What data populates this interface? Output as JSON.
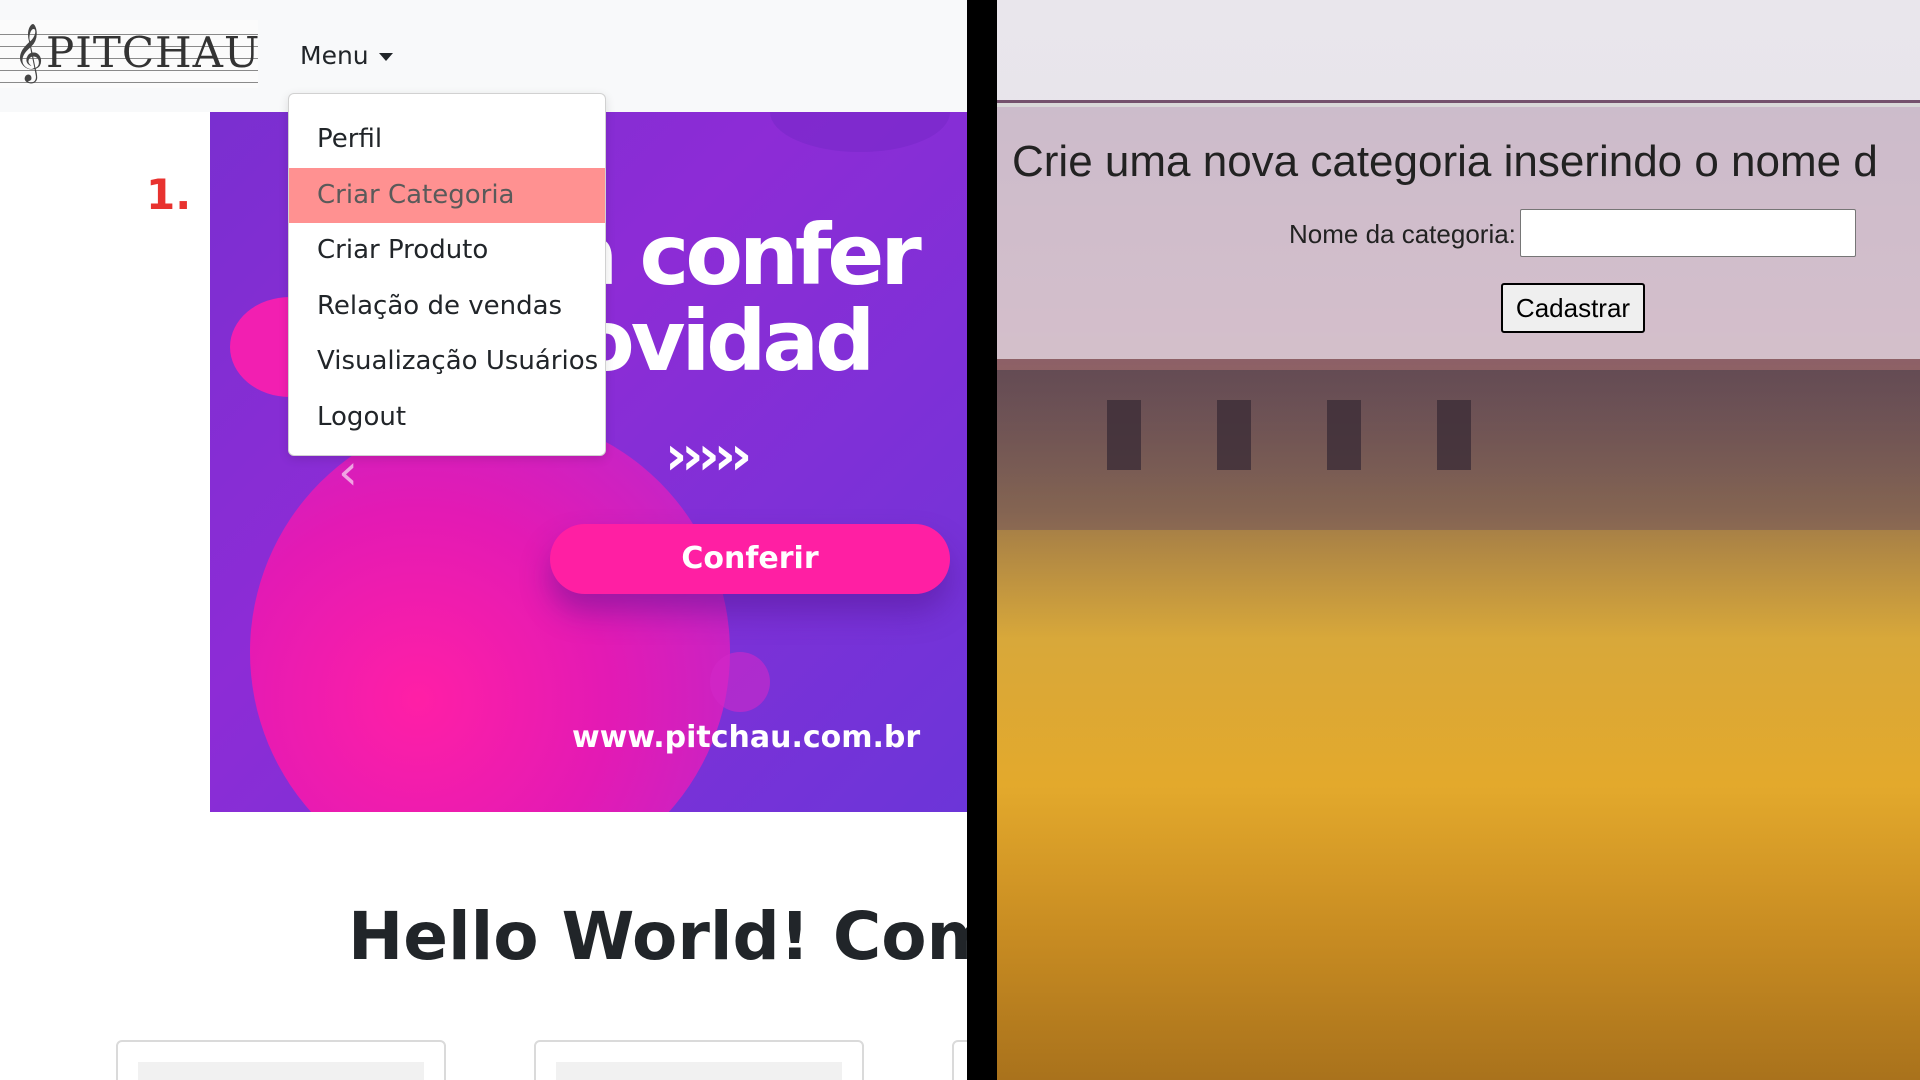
{
  "left_panel": {
    "navbar": {
      "logo_text": "PITCHAU",
      "menu_label": "Menu"
    },
    "dropdown": {
      "items": [
        {
          "label": "Perfil"
        },
        {
          "label": "Criar Categoria",
          "active": true
        },
        {
          "label": "Criar Produto"
        },
        {
          "label": "Relação de vendas"
        },
        {
          "label": "Visualização Usuários"
        },
        {
          "label": "Logout"
        }
      ]
    },
    "banner": {
      "headline_line1": "nha confer",
      "headline_line2": "s novidad",
      "arrows": "›››››",
      "button_label": "Conferir",
      "url": "www.pitchau.com.br"
    },
    "step_label": "1.",
    "heading": "Hello World! Compr",
    "colors": {
      "highlight": "#ff9191",
      "banner_purple": "#7a2fd0",
      "banner_pink": "#ff1fa3",
      "step_red": "#e8322f"
    }
  },
  "right_panel": {
    "form": {
      "title": "Crie uma nova categoria inserindo o nome d",
      "field_label": "Nome da categoria:",
      "field_value": "",
      "submit_label": "Cadastrar"
    }
  },
  "icons": {
    "caret": "caret-down-icon",
    "carousel_prev": "chevron-left-icon",
    "logo_clef": "treble-clef-icon"
  }
}
